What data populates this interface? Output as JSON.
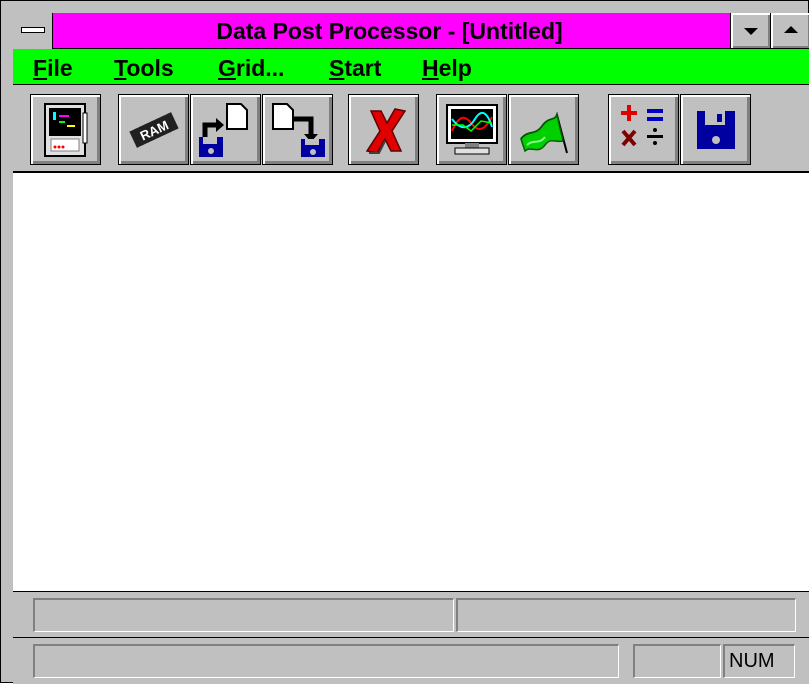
{
  "window": {
    "title": "Data Post Processor - [Untitled]",
    "title_bar_color": "#ff00ff",
    "menu_bar_color": "#00ff00"
  },
  "menu": {
    "file": {
      "accel": "F",
      "rest": "ile"
    },
    "tools": {
      "accel": "T",
      "rest": "ools"
    },
    "grid": {
      "accel": "G",
      "rest": "rid..."
    },
    "start": {
      "accel": "S",
      "rest": "tart"
    },
    "help": {
      "accel": "H",
      "rest": "elp"
    }
  },
  "toolbar": {
    "buttons": [
      {
        "icon": "computer-tower-icon"
      },
      {
        "icon": "ram-chip-icon"
      },
      {
        "icon": "load-file-icon"
      },
      {
        "icon": "save-file-icon"
      },
      {
        "icon": "delete-x-icon"
      },
      {
        "icon": "graph-monitor-icon"
      },
      {
        "icon": "green-flag-icon"
      },
      {
        "icon": "math-operations-icon"
      },
      {
        "icon": "floppy-disk-icon"
      }
    ],
    "ram_label": "RAM"
  },
  "status": {
    "num_indicator": "NUM"
  }
}
